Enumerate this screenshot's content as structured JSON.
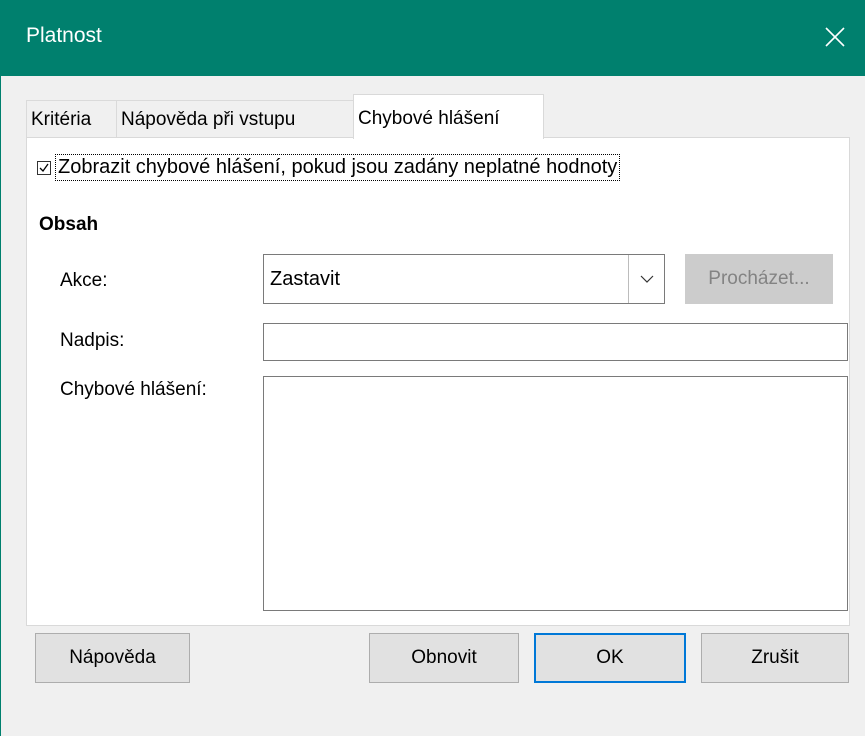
{
  "window": {
    "title": "Platnost"
  },
  "tabs": [
    {
      "label": "Kritéria"
    },
    {
      "label": "Nápověda při vstupu"
    },
    {
      "label": "Chybové hlášení"
    }
  ],
  "active_tab": "Chybové hlášení",
  "show_error": {
    "label": "Zobrazit chybové hlášení, pokud jsou zadány neplatné hodnoty",
    "checked": true
  },
  "content": {
    "heading": "Obsah",
    "action": {
      "label": "Akce:",
      "value": "Zastavit"
    },
    "browse": {
      "label": "Procházet...",
      "enabled": false
    },
    "title_field": {
      "label": "Nadpis:",
      "value": ""
    },
    "error_message": {
      "label": "Chybové hlášení:",
      "value": ""
    }
  },
  "buttons": {
    "help": "Nápověda",
    "reset": "Obnovit",
    "ok": "OK",
    "cancel": "Zrušit"
  },
  "colors": {
    "titlebar": "#00806e",
    "default_button_border": "#0078d7"
  },
  "icons": {
    "close": "close-icon",
    "dropdown": "chevron-down-icon",
    "checkbox": "checkmark-icon"
  }
}
